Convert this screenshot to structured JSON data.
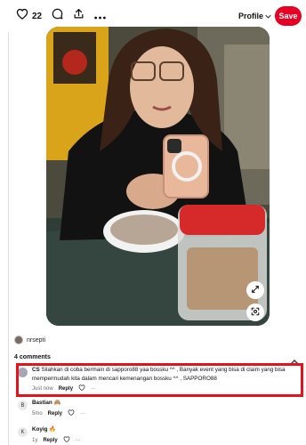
{
  "toolbar": {
    "like_count": "22",
    "profile_label": "Profile",
    "save_label": "Save"
  },
  "colors": {
    "accent": "#e60023",
    "highlight_border": "#e1141b"
  },
  "author": {
    "name": "nrsepti"
  },
  "comments": {
    "header": "4 comments",
    "items": [
      {
        "avatar": "CS",
        "user": "CS",
        "text": "Silahkan di coba bermain di sapporo88 yaa bossku ^^ , Banyak event yang bisa di claim yang bisa mempermudah kita dalam mencari kemenangan bossku ^^ , SAPPORO88",
        "time": "Just now",
        "reply": "Reply"
      },
      {
        "avatar": "B",
        "user": "Bastian",
        "emoji": "🙈",
        "time": "5mo",
        "reply": "Reply"
      },
      {
        "avatar": "K",
        "user": "Koyig",
        "emoji": "🔥",
        "time": "1y",
        "reply": "Reply"
      }
    ]
  },
  "icons": [
    "heart-icon",
    "comment-icon",
    "share-icon",
    "more-icon",
    "chevron-down-icon",
    "expand-icon",
    "visual-search-icon",
    "chevron-up-icon",
    "heart-outline-icon"
  ]
}
